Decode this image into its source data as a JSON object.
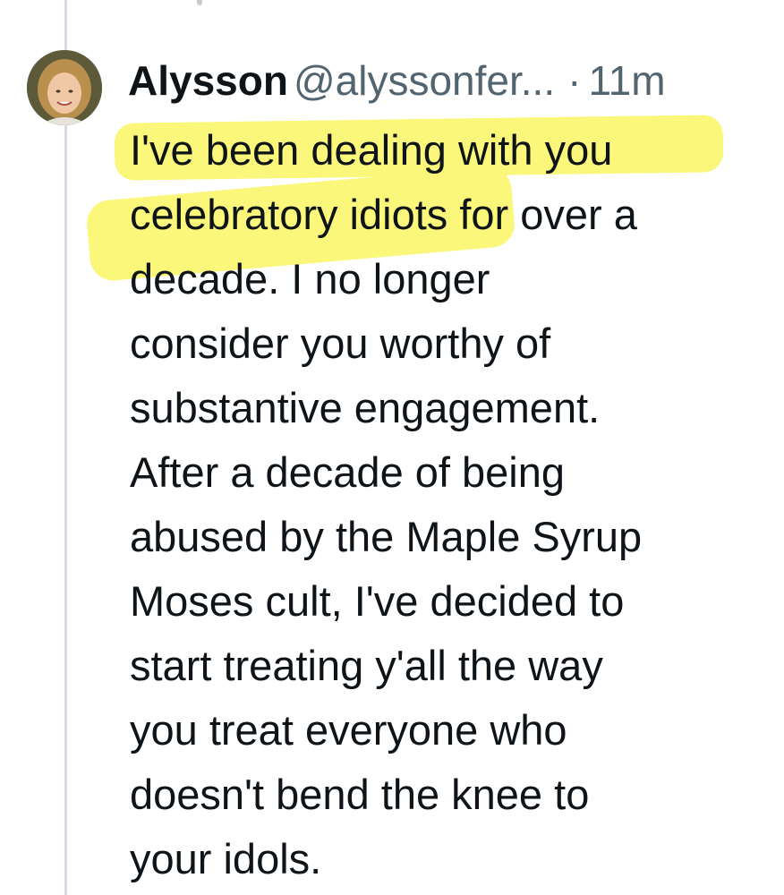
{
  "tweet": {
    "author_name": "Alysson",
    "handle": "@alyssonfer...",
    "separator": "·",
    "time": "11m",
    "lines": [
      "I've been dealing with you",
      "celebratory idiots for over a",
      "decade.  I no longer",
      "consider you worthy of",
      "substantive engagement.",
      "After a decade of being",
      "abused by the Maple Syrup",
      "Moses cult, I've decided to",
      "start treating y'all the way",
      "you treat everyone who",
      "doesn't bend the knee to",
      "your idols."
    ]
  },
  "colors": {
    "highlight": "#fbf77a",
    "muted_text": "#536471",
    "thread_line": "#d5dbe3"
  }
}
